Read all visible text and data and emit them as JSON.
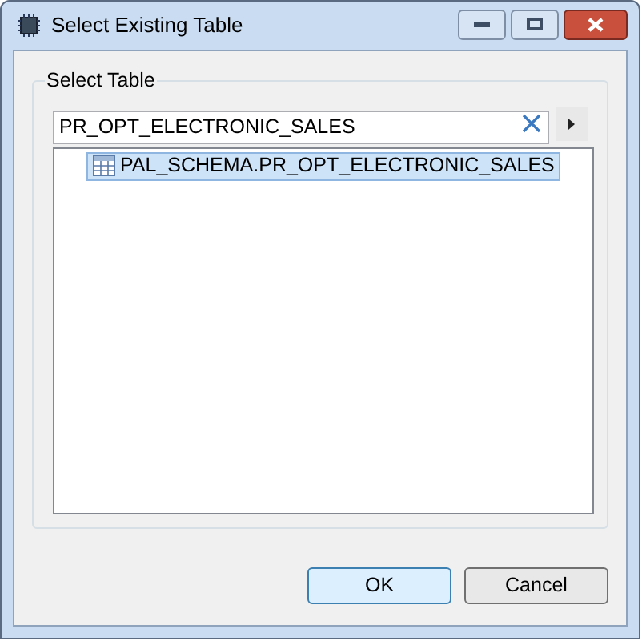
{
  "window": {
    "title": "Select Existing Table"
  },
  "group": {
    "label": "Select Table"
  },
  "search": {
    "value": "PR_OPT_ELECTRONIC_SALES"
  },
  "tree": {
    "items": [
      {
        "label": "PAL_SCHEMA.PR_OPT_ELECTRONIC_SALES",
        "selected": true
      }
    ]
  },
  "buttons": [
    {
      "label": "OK",
      "default": true
    },
    {
      "label": "Cancel",
      "default": false
    }
  ]
}
